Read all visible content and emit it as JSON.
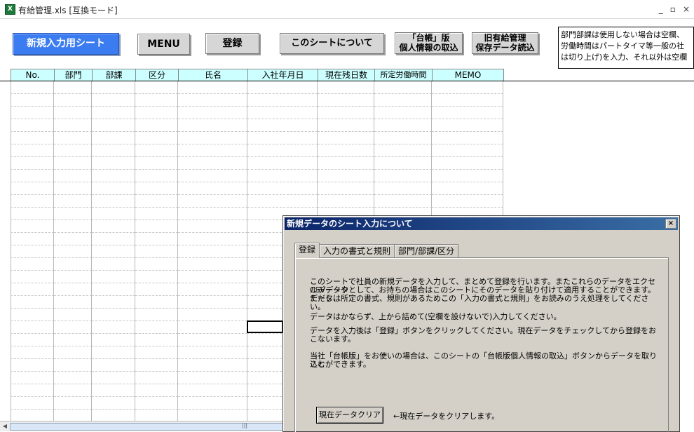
{
  "window": {
    "title": "有給管理.xls  [互換モード]",
    "controls": [
      "_",
      "▫",
      "×"
    ]
  },
  "toolbar": {
    "new_sheet": "新規入力用シート",
    "menu": "MENU",
    "register": "登録",
    "about_sheet": "このシートについて",
    "ledger_import_line1": "「台帳」版",
    "ledger_import_line2": "個人情報の取込",
    "old_data_line1": "旧有給管理",
    "old_data_line2": "保存データ読込"
  },
  "info_box": {
    "line1": "部門部課は使用しない場合は空欄、",
    "line2": "労働時間はパートタイマ等一般の社",
    "line3": "は切り上げ)を入力、それ以外は空欄"
  },
  "grid": {
    "headers": [
      "No.",
      "部門",
      "部課",
      "区分",
      "氏名",
      "入社年月日",
      "現在残日数",
      "所定労働時間",
      "MEMO"
    ],
    "row_count": 27
  },
  "dialog": {
    "title": "新規データのシート入力について",
    "close": "×",
    "tabs": [
      "登録",
      "入力の書式と規則",
      "部門/部課/区分"
    ],
    "active_tab": "登録",
    "para1_line1": "このシートで社員の新規データを入力して、まとめて登録を行います。またこれらのデータをエクセルデータや",
    "para1_line2": "CSVデータとして、お持ちの場合はこのシートにそのデータを貼り付けて適用することができます。ただし、",
    "para1_line3": "データは所定の書式、規則があるためこの「入力の書式と規則」をお読みのうえ処理をしてください。",
    "para2": "データはかならず、上から詰めて(空欄を設けないで)入力してください。",
    "para3": "データを入力後は「登録」ボタンをクリックしてください。現在データをチェックしてから登録をおこないます。",
    "para4_line1": "当社「台帳版」をお使いの場合は、このシートの「台帳版個人情報の取込」ボタンからデータを取り込む",
    "para4_line2": "ことができます。",
    "clear_button": "現在データクリア",
    "clear_note": "←現在データをクリアします。"
  },
  "scrollbar": {
    "thumb_label": "|||"
  },
  "colors": {
    "header_bg": "#ccffff",
    "primary_button": "#3b7cf0",
    "dialog_title": "#0a246a"
  }
}
